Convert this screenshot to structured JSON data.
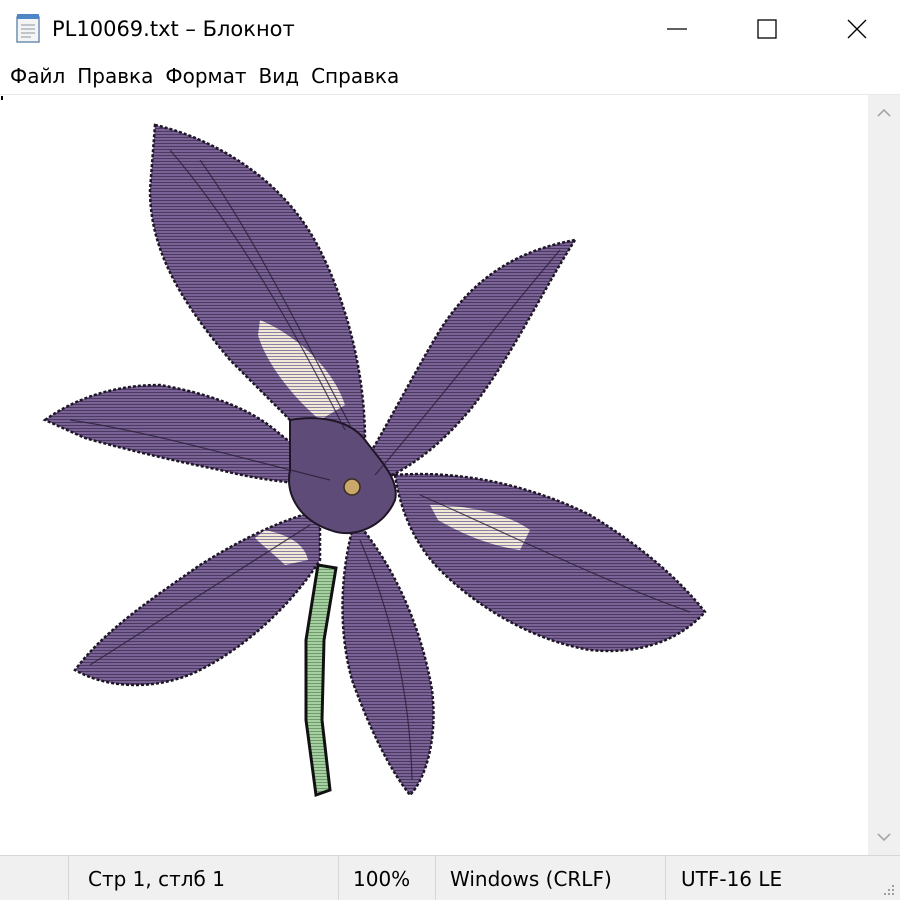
{
  "window": {
    "title": "PL10069.txt – Блокнот",
    "app_icon": "notepad-icon",
    "controls": [
      "minimize-icon",
      "maximize-icon",
      "close-icon"
    ]
  },
  "menu": {
    "items": [
      {
        "label": "Файл"
      },
      {
        "label": "Правка"
      },
      {
        "label": "Формат"
      },
      {
        "label": "Вид"
      },
      {
        "label": "Справка"
      }
    ]
  },
  "editor": {
    "content": "ascii-art purple iris flower with green stem",
    "colors": {
      "petal": "#7a6296",
      "petal_dark": "#4f3d66",
      "vein": "#2e2240",
      "highlight": "#f3eedc",
      "stem": "#9fcb9b",
      "center": "#c9a86a"
    }
  },
  "scrollbar": {
    "up_icon": "chevron-up-icon",
    "down_icon": "chevron-down-icon"
  },
  "status": {
    "position": "Стр 1, стлб 1",
    "zoom": "100%",
    "line_ending": "Windows (CRLF)",
    "encoding": "UTF-16 LE"
  },
  "theme": {
    "statusbar_bg": "#f0f0f0",
    "scrollbar_bg": "#f0f0f0"
  }
}
